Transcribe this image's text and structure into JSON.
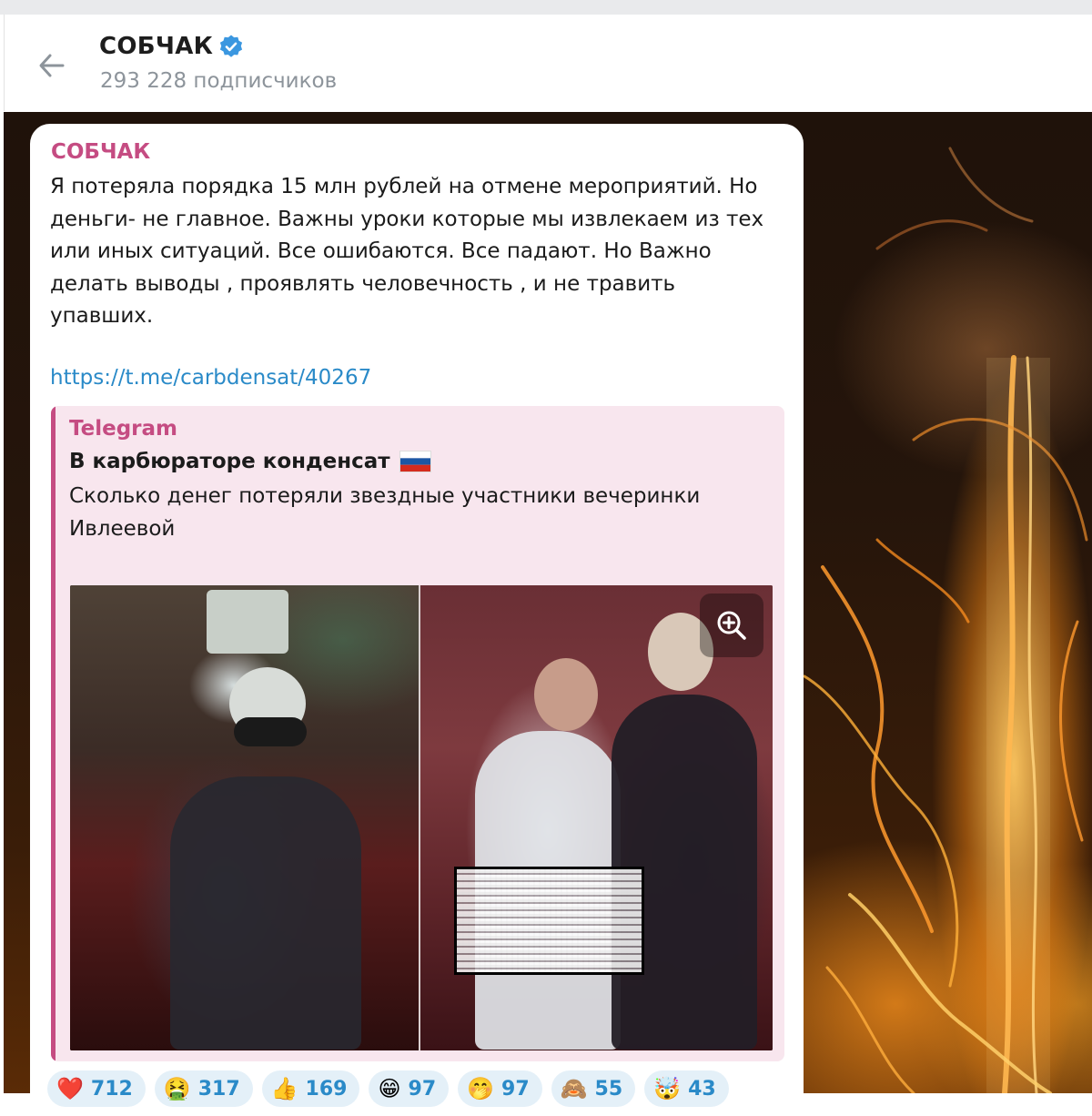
{
  "header": {
    "channel_name": "СОБЧАК",
    "subscribers": "293 228 подписчиков"
  },
  "message": {
    "author": "СОБЧАК",
    "text_lines": [
      "Я потеряла порядка 15 млн рублей на отмене мероприятий. Но",
      "деньги- не главное. Важны уроки которые мы извлекаем из тех",
      "или иных ситуаций. Все ошибаются. Все падают. Но Важно",
      "делать выводы , проявлять человечность , и не травить",
      "упавших."
    ],
    "link": "https://t.me/carbdensat/40267",
    "preview": {
      "site": "Telegram",
      "title": "В карбюраторе конденсат",
      "title_flag_icon": "russia-flag-icon",
      "desc_lines": [
        "Сколько денег потеряли звездные участники вечеринки",
        "Ивлеевой"
      ],
      "ellipsis": "..."
    }
  },
  "reactions": [
    {
      "emoji": "❤️",
      "count": "712"
    },
    {
      "emoji": "🤮",
      "count": "317"
    },
    {
      "emoji": "👍",
      "count": "169"
    },
    {
      "emoji": "😁",
      "count": "97"
    },
    {
      "emoji": "🤭",
      "count": "97"
    },
    {
      "emoji": "🙈",
      "count": "55"
    },
    {
      "emoji": "🤯",
      "count": "43"
    }
  ],
  "colors": {
    "accent_pink": "#c54c82",
    "link_blue": "#2a8ac8",
    "verified_blue": "#3b97e0",
    "preview_bg": "#f8e6ee",
    "reaction_bg": "#e4f0f8"
  }
}
